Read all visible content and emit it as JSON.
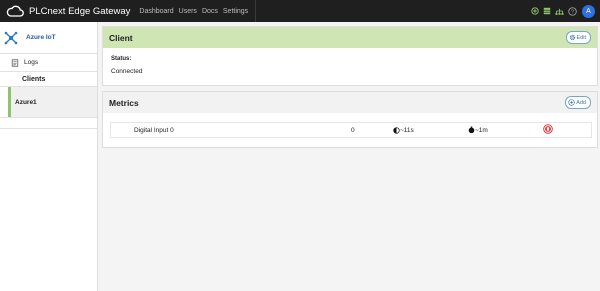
{
  "topbar": {
    "app_name": "PLCnext Edge Gateway",
    "nav": [
      "Dashboard",
      "Users",
      "Docs",
      "Settings"
    ],
    "icons": [
      "add-circle-icon",
      "grid-icon",
      "network-icon",
      "help-icon"
    ],
    "avatar_letter": "A"
  },
  "sidebar": {
    "app_title": "Azure IoT",
    "logs_label": "Logs",
    "clients_header": "Clients",
    "clients": [
      "Azure1"
    ]
  },
  "client_card": {
    "title": "Client",
    "edit_label": "Edit",
    "status_label": "Status:",
    "status_value": "Connected"
  },
  "metrics_card": {
    "title": "Metrics",
    "add_label": "Add",
    "rows": [
      {
        "name": "Digital Input 0",
        "value": "0",
        "interval_1": "~11s",
        "interval_2": "~1m"
      }
    ]
  },
  "colors": {
    "topbar": "#1f1f1f",
    "client_header": "#cfe6b4",
    "accent_green": "#8fc46a",
    "accent_blue": "#3a78b2",
    "avatar": "#2f6fe4",
    "delete_red": "#d9262b"
  }
}
